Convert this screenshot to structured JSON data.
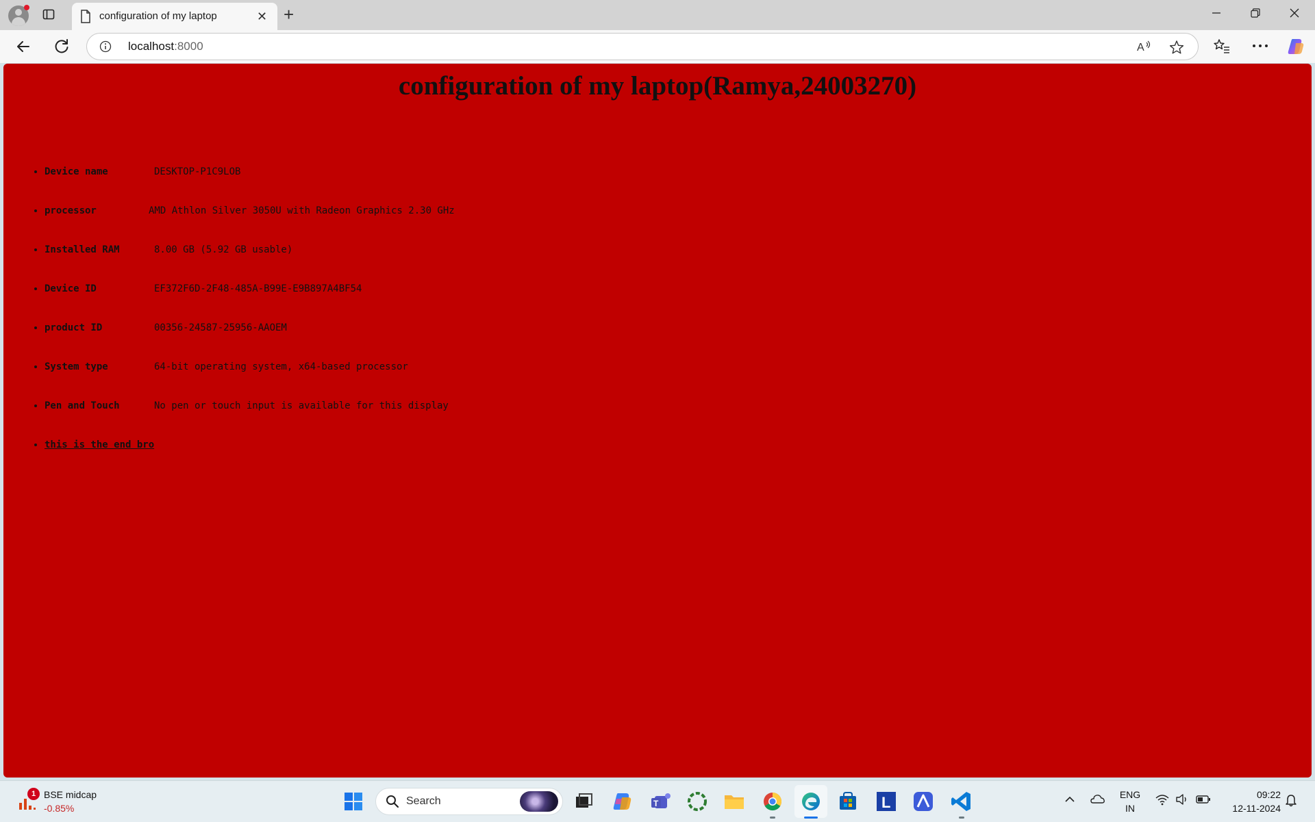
{
  "browser": {
    "tab_title": "configuration of my laptop",
    "url_host": "localhost",
    "url_port": ":8000",
    "new_tab_symbol": "+",
    "close_symbol": "✕"
  },
  "page": {
    "title": "configuration of my laptop(Ramya,24003270)",
    "specs": [
      {
        "key": "Device name",
        "value": "DESKTOP-P1C9LOB"
      },
      {
        "key": "processor",
        "value": "AMD Athlon Silver 3050U with Radeon Graphics 2.30 GHz"
      },
      {
        "key": "Installed RAM",
        "value": "8.00 GB (5.92 GB usable)"
      },
      {
        "key": "Device ID",
        "value": "EF372F6D-2F48-485A-B99E-E9B897A4BF54"
      },
      {
        "key": "product ID",
        "value": "00356-24587-25956-AAOEM"
      },
      {
        "key": "System type",
        "value": "64-bit operating system, x64-based processor"
      },
      {
        "key": "Pen and Touch",
        "value": "No pen or touch input is available for this display"
      }
    ],
    "end_link": "this is the end bro",
    "background_color": "#c00000"
  },
  "taskbar": {
    "widget_name": "BSE midcap",
    "widget_change": "-0.85%",
    "widget_badge": "1",
    "search_placeholder": "Search",
    "language_line1": "ENG",
    "language_line2": "IN",
    "time": "09:22",
    "date": "12-11-2024",
    "app_icons": [
      "windows-start-icon",
      "search-icon",
      "task-view-icon",
      "copilot-icon",
      "teams-icon",
      "refresh-app-icon",
      "file-explorer-icon",
      "chrome-icon",
      "edge-icon",
      "store-icon",
      "l-app-icon",
      "azure-icon",
      "vscode-icon"
    ]
  }
}
